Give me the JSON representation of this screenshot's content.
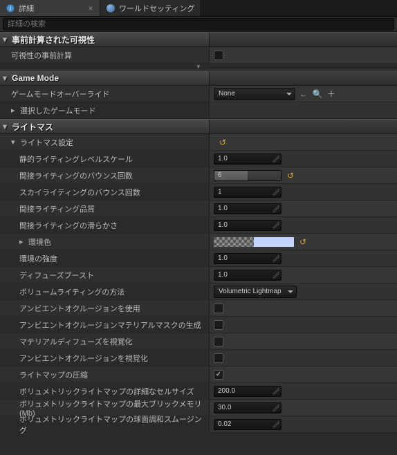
{
  "tabs": [
    {
      "label": "詳細",
      "close": "×"
    },
    {
      "label": "ワールドセッティング"
    }
  ],
  "search": {
    "placeholder": "詳細の検索"
  },
  "cat_precomputed": {
    "title": "事前計算された可視性"
  },
  "rows": {
    "precompute_vis": "可視性の事前計算"
  },
  "cat_gamemode": {
    "title": "Game Mode"
  },
  "gm": {
    "override_label": "ゲームモードオーバーライド",
    "override_value": "None",
    "selected_label": "選択したゲームモード"
  },
  "cat_lightmass": {
    "title": "ライトマス"
  },
  "lm": {
    "settings_label": "ライトマス設定",
    "static_level_scale": {
      "label": "静的ライティングレベルスケール",
      "value": "1.0"
    },
    "bounce_count": {
      "label": "間接ライティングのバウンス回数",
      "value": "6"
    },
    "sky_bounce": {
      "label": "スカイライティングのバウンス回数",
      "value": "1"
    },
    "indirect_quality": {
      "label": "間接ライティング品質",
      "value": "1.0"
    },
    "indirect_smooth": {
      "label": "間接ライティングの滑らかさ",
      "value": "1.0"
    },
    "env_color": {
      "label": "環境色"
    },
    "env_intensity": {
      "label": "環境の強度",
      "value": "1.0"
    },
    "diffuse_boost": {
      "label": "ディフューズブースト",
      "value": "1.0"
    },
    "volume_method": {
      "label": "ボリュームライティングの方法",
      "value": "Volumetric Lightmap"
    },
    "use_ao": {
      "label": "アンビエントオクルージョンを使用"
    },
    "gen_ao_mask": {
      "label": "アンビエントオクルージョンマテリアルマスクの生成"
    },
    "vis_mat_diffuse": {
      "label": "マテリアルディフューズを視覚化"
    },
    "vis_ao": {
      "label": "アンビエントオクルージョンを視覚化"
    },
    "compress_lm": {
      "label": "ライトマップの圧縮"
    },
    "cell_size": {
      "label": "ボリュメトリックライトマップの詳細なセルサイズ",
      "value": "200.0"
    },
    "max_brick_mem": {
      "label": "ボリュメトリックライトマップの最大ブリックメモリ(Mb)",
      "value": "30.0"
    },
    "spherical_smooth": {
      "label": "ボリュメトリックライトマップの球面調和スムージング",
      "value": "0.02"
    }
  }
}
